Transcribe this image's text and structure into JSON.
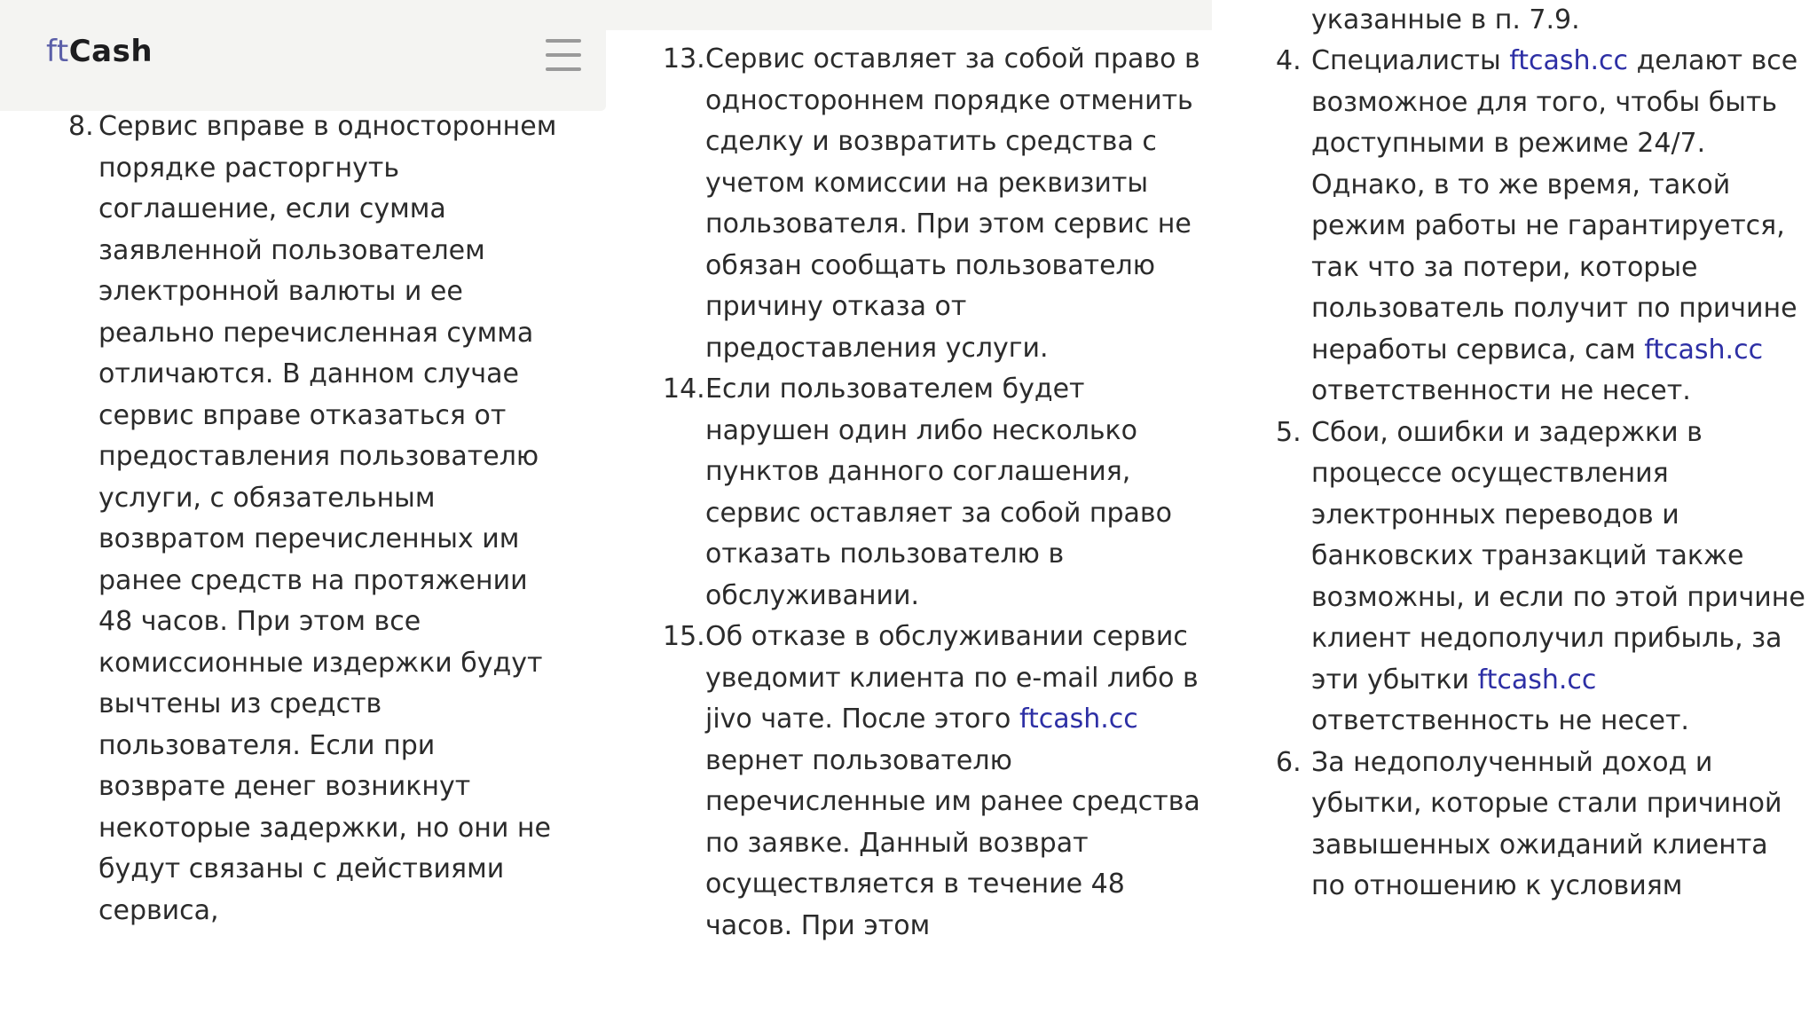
{
  "header": {
    "logo_prefix": "ft",
    "logo_suffix": "Cash",
    "menu_icon": "hamburger-menu-icon"
  },
  "colors": {
    "link": "#2d2fa5",
    "logo_accent": "#5b5fa8",
    "header_bg": "#f4f4f2",
    "text": "#2b2b2b"
  },
  "column1": {
    "items": [
      {
        "number": "8.",
        "text": "Сервис вправе в одностороннем порядке расторгнуть соглашение, если сумма заявленной пользователем электронной валюты и ее реально перечисленная сумма отличаются. В данном случае сервис вправе отказаться от предоставления пользователю услуги, с обязательным возвратом перечисленных им ранее средств на протяжении 48 часов. При этом все комиссионные издержки будут вычтены из средств пользователя. Если при возврате денег возникнут некоторые задержки, но они не будут связаны с действиями сервиса,"
      }
    ]
  },
  "column2": {
    "items": [
      {
        "number": "13.",
        "text": "Сервис оставляет за собой право в одностороннем порядке отменить сделку и возвратить средства с учетом комиссии на реквизиты пользователя. При этом сервис не обязан сообщать пользователю причину отказа от предоставления услуги."
      },
      {
        "number": "14.",
        "text": "Если пользователем будет нарушен один либо несколько пунктов данного соглашения, сервис оставляет за собой право отказать пользователю в обслуживании."
      },
      {
        "number": "15.",
        "text_before_link": "Об отказе в обслуживании сервис уведомит клиента по e-mail либо в jivo чате. После этого ",
        "link": "ftcash.cc",
        "text_after_link": " вернет пользователю перечисленные им ранее средства по заявке. Данный возврат осуществляется в течение 48 часов. При этом"
      }
    ]
  },
  "column3": {
    "cut_line": "указанные в п. 7.9.",
    "items": [
      {
        "number": "4.",
        "text_before_link": "Специалисты ",
        "link": "ftcash.cc",
        "text_middle": " делают все возможное для того, чтобы быть доступными в режиме 24/7. Однако, в то же время, такой режим работы не гарантируется, так что за потери, которые пользователь получит по причине неработы сервиса, сам ",
        "link2": "ftcash.cc",
        "text_after_link": " ответственности не несет."
      },
      {
        "number": "5.",
        "text_before_link": "Сбои, ошибки и задержки в процессе осуществления электронных переводов и банковских транзакций также возможны, и если по этой причине клиент недополучил прибыль, за эти убытки ",
        "link": "ftcash.cc",
        "text_after_link": " ответственность не несет."
      },
      {
        "number": "6.",
        "text": "За недополученный доход и убытки, которые стали причиной завышенных ожиданий клиента по отношению к условиям"
      }
    ]
  }
}
